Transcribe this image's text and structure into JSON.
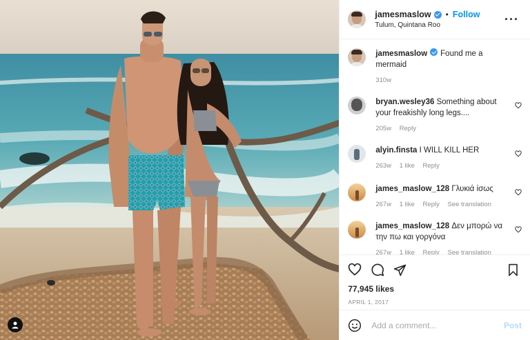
{
  "header": {
    "username": "jamesmaslow",
    "separator": "•",
    "follow_label": "Follow",
    "location": "Tulum, Quintana Roo",
    "more_icon": "more-horizontal-icon"
  },
  "caption": {
    "username": "jamesmaslow",
    "text": "Found me a mermaid",
    "age": "310w"
  },
  "comments": [
    {
      "username": "bryan.wesley36",
      "text": "Something about your freakishly long legs....",
      "age": "205w",
      "likes": "",
      "reply": "Reply",
      "translate": ""
    },
    {
      "username": "alyin.finsta",
      "text": "I WILL KILL HER",
      "age": "263w",
      "likes": "1 like",
      "reply": "Reply",
      "translate": ""
    },
    {
      "username": "james_maslow_128",
      "text": "Γλυκιά ίσως",
      "age": "267w",
      "likes": "1 like",
      "reply": "Reply",
      "translate": "See translation"
    },
    {
      "username": "james_maslow_128",
      "text": "Δεν μπορώ να την πω και γοργόνα",
      "age": "267w",
      "likes": "1 like",
      "reply": "Reply",
      "translate": "See translation"
    }
  ],
  "actions": {
    "likes": "77,945 likes",
    "date": "APRIL 1, 2017"
  },
  "add_comment": {
    "placeholder": "Add a comment...",
    "post_label": "Post"
  },
  "colors": {
    "accent": "#0095f6",
    "verified": "#3897f0",
    "muted": "#8e8e8e",
    "post_disabled": "#b3dbff"
  }
}
